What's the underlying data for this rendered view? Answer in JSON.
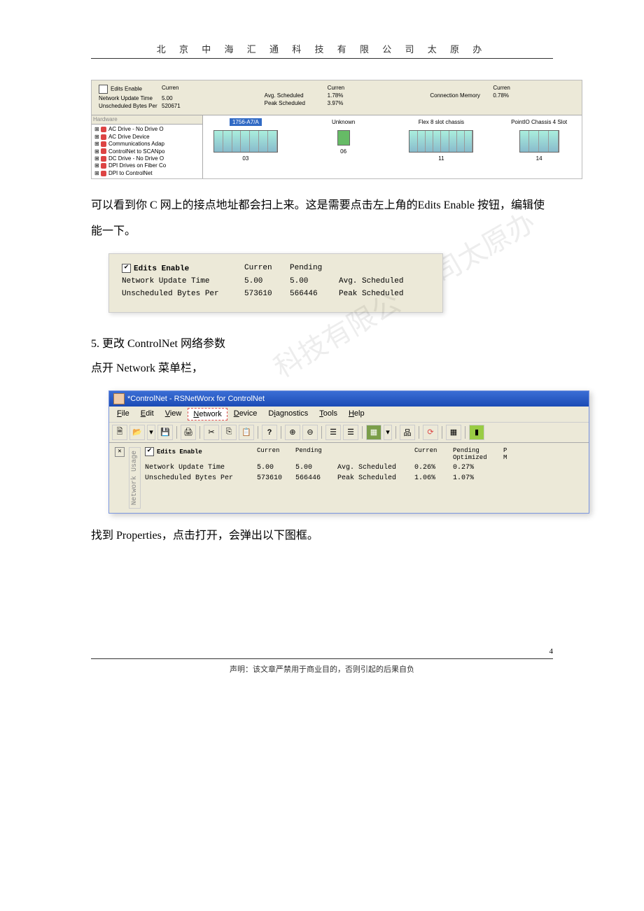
{
  "header": {
    "title": "北 京 中 海 汇 通 科 技 有 限 公 司 太 原 办"
  },
  "fig1": {
    "top": {
      "editsEnable": "Edits Enable",
      "netUpdateLabel": "Network Update Time",
      "netUpdateCurren": "5.00",
      "unschedLabel": "Unscheduled Bytes Per",
      "unschedCurren": "520671",
      "currenHdr": "Curren",
      "avgSchedLabel": "Avg. Scheduled",
      "avgSchedCurren": "1.78%",
      "peakSchedLabel": "Peak Scheduled",
      "peakSchedCurren": "3.97%",
      "connMemLabel": "Connection Memory",
      "connMemCurren": "0.78%"
    },
    "tree": {
      "header": "Hardware",
      "items": [
        "AC Drive - No Drive O",
        "AC Drive Device",
        "Communications Adap",
        "ControlNet to SCANpo",
        "DC Drive - No Drive O",
        "DPI Drives on Fiber Co",
        "DPI to ControlNet"
      ]
    },
    "nodes": [
      {
        "title": "1756-A7/A",
        "num": "03",
        "type": "rack",
        "selected": true
      },
      {
        "title": "Unknown",
        "num": "06",
        "type": "green"
      },
      {
        "title": "Flex 8 slot chassis",
        "num": "11",
        "type": "rack"
      },
      {
        "title": "PointIO Chassis 4 Slot",
        "num": "14",
        "type": "rack"
      }
    ]
  },
  "para1": "可以看到你 C 网上的接点地址都会扫上来。这是需要点击左上角的Edits Enable 按钮，编辑使能一下。",
  "fig2": {
    "editsEnable": "Edits Enable",
    "currenHdr": "Curren",
    "pendingHdr": "Pending",
    "netRow": {
      "label": "Network Update Time",
      "curren": "5.00",
      "pending": "5.00",
      "right": "Avg. Scheduled"
    },
    "unschedRow": {
      "label": "Unscheduled Bytes Per",
      "curren": "573610",
      "pending": "566446",
      "right": "Peak Scheduled"
    }
  },
  "section5": "5. 更改 ControlNet 网络参数",
  "para2": "点开 Network 菜单栏，",
  "fig3": {
    "title": "*ControlNet - RSNetWorx for ControlNet",
    "menus": {
      "file": "File",
      "edit": "Edit",
      "view": "View",
      "network": "Network",
      "device": "Device",
      "diagnostics": "Diagnostics",
      "tools": "Tools",
      "help": "Help"
    },
    "sideTab": "Network Usage",
    "hdrs": {
      "curren": "Curren",
      "pending": "Pending",
      "curren2": "Curren",
      "pendOpt": "Pending\nOptimized",
      "pm": "P\nM"
    },
    "editsEnable": "Edits Enable",
    "rows": [
      {
        "label": "Network Update Time",
        "c1": "5.00",
        "c2": "5.00",
        "c3": "Avg. Scheduled",
        "c4": "0.26%",
        "c5": "0.27%"
      },
      {
        "label": "Unscheduled Bytes Per",
        "c1": "573610",
        "c2": "566446",
        "c3": "Peak Scheduled",
        "c4": "1.06%",
        "c5": "1.07%"
      }
    ]
  },
  "para3": "找到 Properties，点击打开，会弹出以下图框。",
  "footer": {
    "pageNum": "4",
    "text": "声明：该文章严禁用于商业目的，否则引起的后果自负"
  }
}
